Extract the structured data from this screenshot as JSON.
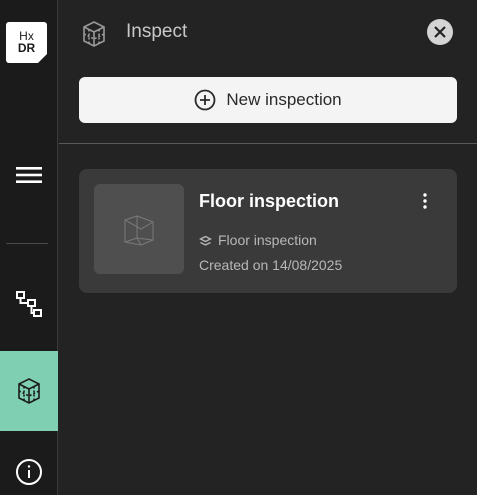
{
  "logo": {
    "line1": "Hx",
    "line2": "DR"
  },
  "rail": {
    "items": [
      {
        "name": "menu-icon"
      },
      {
        "name": "tree-icon"
      },
      {
        "name": "inspect-icon",
        "active": true
      },
      {
        "name": "info-icon"
      }
    ]
  },
  "panel": {
    "title": "Inspect",
    "new_button_label": "New inspection"
  },
  "inspections": [
    {
      "title": "Floor inspection",
      "type_label": "Floor inspection",
      "created": "Created on 14/08/2025"
    }
  ],
  "colors": {
    "accent": "#7fcfb3",
    "background": "#232323",
    "card": "#3a3a3a"
  }
}
